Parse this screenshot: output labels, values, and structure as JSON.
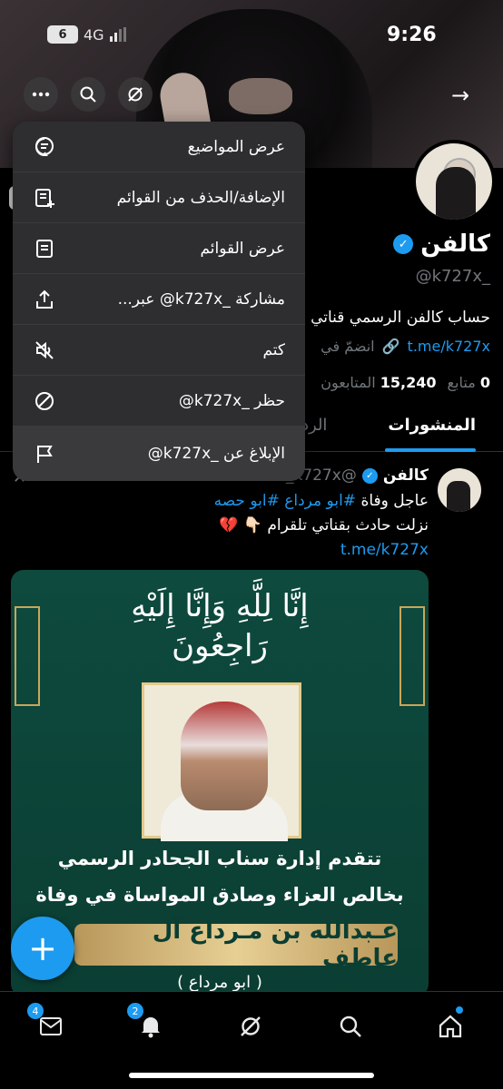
{
  "status_bar": {
    "time": "9:26",
    "notif_count": "6",
    "network": "4G"
  },
  "header": {
    "back_arrow": "→"
  },
  "profile": {
    "name": "كالفن",
    "handle": "@k727x_",
    "bio": "حساب كالفن الرسمي قناتي",
    "link": "t.me/k727x",
    "joined": "انضمّ في",
    "following_count": "0",
    "following_label": "متابع",
    "followers_count": "15,240",
    "followers_label": "المتابعون"
  },
  "tabs": {
    "active": "المنشورات",
    "second": "الرد"
  },
  "post": {
    "author": "كالفن",
    "handle": "@k727x_",
    "line1_text": "عاجل وفاة",
    "hashtag1": "#ابو مرداع",
    "hashtag2": "#ابو حصه",
    "line2": "نزلت حادث بقناتي تلقرام 👇🏻 💔",
    "link": "t.me/k727x",
    "image": {
      "calligraphy": "إِنَّا لِلَّهِ وَإِنَّا إِلَيْهِ رَاجِعُونَ",
      "line1": "تتقدم إدارة سناب الجحادر الرسمي",
      "line2": "بخالص العزاء وصادق المواساة في وفاة",
      "name_band": "عـبدالله بن مـرداع آل عاطف",
      "nickname": "( ابو مرداع )"
    }
  },
  "menu": {
    "items": [
      {
        "label": "عرض المواضيع",
        "icon": "topics-icon"
      },
      {
        "label": "الإضافة/الحذف من القوائم",
        "icon": "list-add-icon"
      },
      {
        "label": "عرض القوائم",
        "icon": "lists-icon"
      },
      {
        "label": "مشاركة _k727x@ عبر...",
        "icon": "share-icon"
      },
      {
        "label": "كتم",
        "icon": "mute-icon"
      },
      {
        "label": "حظر _k727x@",
        "icon": "block-icon"
      },
      {
        "label": "الإبلاغ عن _k727x@",
        "icon": "report-flag-icon"
      }
    ]
  },
  "bottom_nav": {
    "messages_badge": "4",
    "notifications_badge": "2"
  },
  "colors": {
    "accent": "#1d9bf0",
    "menu_bg": "#2e2e30",
    "background": "#000000"
  }
}
